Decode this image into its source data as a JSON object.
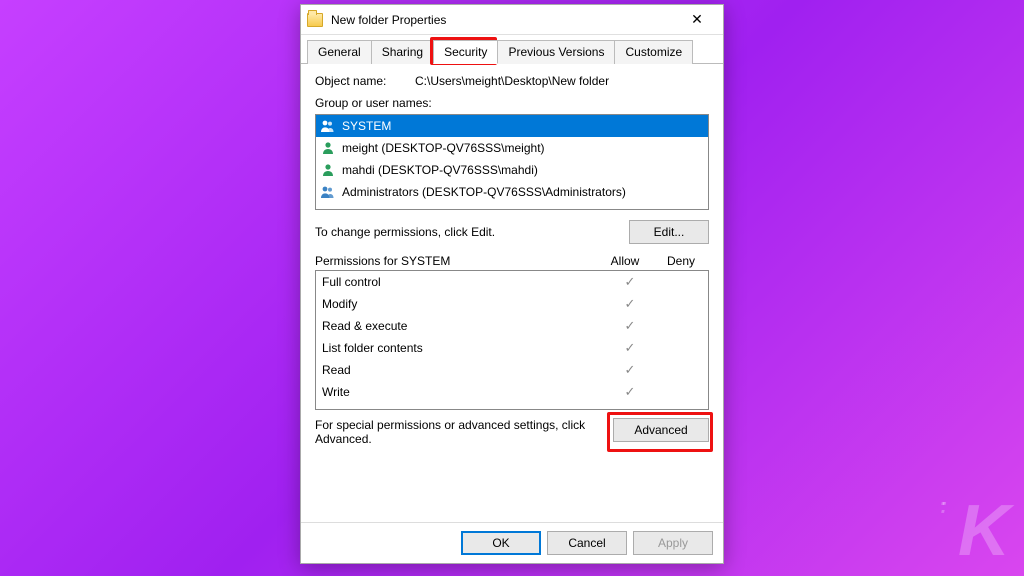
{
  "window": {
    "title": "New folder Properties",
    "close": "✕"
  },
  "tabs": [
    {
      "label": "General",
      "active": false
    },
    {
      "label": "Sharing",
      "active": false
    },
    {
      "label": "Security",
      "active": true
    },
    {
      "label": "Previous Versions",
      "active": false
    },
    {
      "label": "Customize",
      "active": false
    }
  ],
  "object_name_label": "Object name:",
  "object_name_value": "C:\\Users\\meight\\Desktop\\New folder",
  "group_label": "Group or user names:",
  "users": [
    {
      "label": "SYSTEM",
      "type": "group",
      "selected": true
    },
    {
      "label": "meight (DESKTOP-QV76SSS\\meight)",
      "type": "single",
      "selected": false
    },
    {
      "label": "mahdi (DESKTOP-QV76SSS\\mahdi)",
      "type": "single",
      "selected": false
    },
    {
      "label": "Administrators (DESKTOP-QV76SSS\\Administrators)",
      "type": "group",
      "selected": false
    }
  ],
  "edit_hint": "To change permissions, click Edit.",
  "edit_button": "Edit...",
  "perm_header": {
    "name": "Permissions for SYSTEM",
    "allow": "Allow",
    "deny": "Deny"
  },
  "permissions": [
    {
      "name": "Full control",
      "allow": true,
      "deny": false
    },
    {
      "name": "Modify",
      "allow": true,
      "deny": false
    },
    {
      "name": "Read & execute",
      "allow": true,
      "deny": false
    },
    {
      "name": "List folder contents",
      "allow": true,
      "deny": false
    },
    {
      "name": "Read",
      "allow": true,
      "deny": false
    },
    {
      "name": "Write",
      "allow": true,
      "deny": false
    }
  ],
  "advanced_hint": "For special permissions or advanced settings, click Advanced.",
  "advanced_button": "Advanced",
  "footer": {
    "ok": "OK",
    "cancel": "Cancel",
    "apply": "Apply"
  },
  "watermark": "K"
}
